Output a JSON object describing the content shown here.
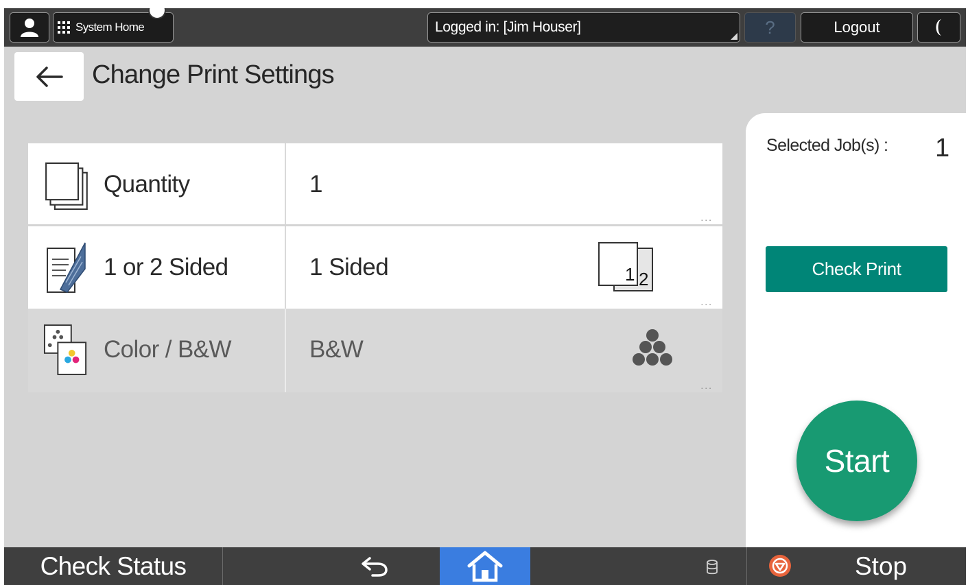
{
  "topbar": {
    "system_home_label": "System Home",
    "login_status": "Logged in: [Jim Houser]",
    "help_label": "?",
    "logout_label": "Logout"
  },
  "header": {
    "title": "Change Print Settings"
  },
  "settings": [
    {
      "label": "Quantity",
      "value": "1",
      "icon": "stacked-pages-icon",
      "enabled": true
    },
    {
      "label": "1 or 2 Sided",
      "value": "1 Sided",
      "icon": "duplex-sheet-icon",
      "value_icon": "one-sided-pages-icon",
      "enabled": true
    },
    {
      "label": "Color / B&W",
      "value": "B&W",
      "icon": "color-mode-icon",
      "value_icon": "black-toner-dots-icon",
      "enabled": false
    }
  ],
  "more_indicator": "...",
  "side_panel": {
    "selected_jobs_label": "Selected Job(s) :",
    "selected_jobs_count": "1",
    "check_print_label": "Check Print",
    "start_label": "Start"
  },
  "bottombar": {
    "check_status_label": "Check Status",
    "stop_label": "Stop"
  },
  "colors": {
    "teal_button": "#008577",
    "start_green": "#189a72",
    "home_blue": "#3a7de0",
    "stop_orange": "#e8643c",
    "bar_dark": "#3e3e3e"
  }
}
